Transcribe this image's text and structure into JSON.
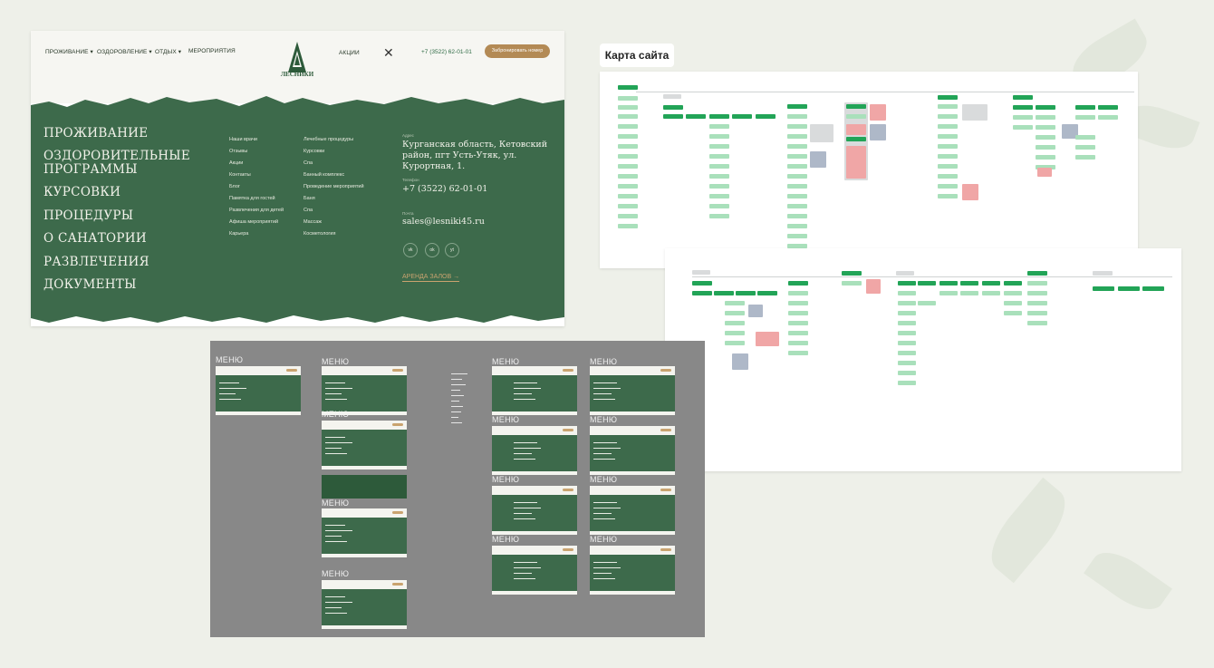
{
  "mockup": {
    "nav": [
      {
        "label": "ПРОЖИВАНИЕ",
        "caret": "▾"
      },
      {
        "label": "ОЗДОРОВЛЕНИЕ",
        "caret": "▾"
      },
      {
        "label": "ОТДЫХ",
        "caret": "▾"
      },
      {
        "label": "МЕРОПРИЯТИЯ",
        "caret": ""
      }
    ],
    "logo_text": "ЛЕСНИКИ",
    "promo_link": "АКЦИИ",
    "close_icon": "close-icon",
    "phone": "+7 (3522) 62-01-01",
    "book_button": "Забронировать номер",
    "menu": [
      "ПРОЖИВАНИЕ",
      "ОЗДОРОВИТЕЛЬНЫЕ ПРОГРАММЫ",
      "КУРСОВКИ",
      "ПРОЦЕДУРЫ",
      "О САНАТОРИИ",
      "РАЗВЛЕЧЕНИЯ",
      "ДОКУМЕНТЫ"
    ],
    "col1": [
      "Наши врачи",
      "Отзывы",
      "Акции",
      "Контакты",
      "Блог",
      "Памятка для гостей",
      "Развлечения для детей",
      "Афиша мероприятий",
      "Карьера"
    ],
    "col2": [
      "Лечебные процедуры",
      "Курсовки",
      "Спа",
      "Банный комплекс",
      "Проведение мероприятий",
      "Баня",
      "Спа",
      "Массаж",
      "Косметология"
    ],
    "address_label": "Адрес",
    "address": "Курганская область, Кетовский район, пгт Усть-Утяк, ул. Курортная, 1.",
    "phone_label": "Телефон",
    "phone_big": "+7 (3522) 62-01-01",
    "mail_label": "Почта",
    "email": "sales@lesniki45.ru",
    "social": [
      "vk",
      "ok",
      "yt"
    ],
    "rent_link": "АРЕНДА ЗАЛОВ",
    "rent_arrow": "→"
  },
  "sitemap": {
    "title": "Карта сайта"
  },
  "board": {
    "menu_label": "МЕНЮ"
  },
  "colors": {
    "forest": "#3d6a4b",
    "gold": "#b38a55",
    "node_green": "#a9e0bb",
    "node_dark": "#22a457",
    "node_pink": "#f0a6a6",
    "node_blue": "#aeb8c8"
  }
}
